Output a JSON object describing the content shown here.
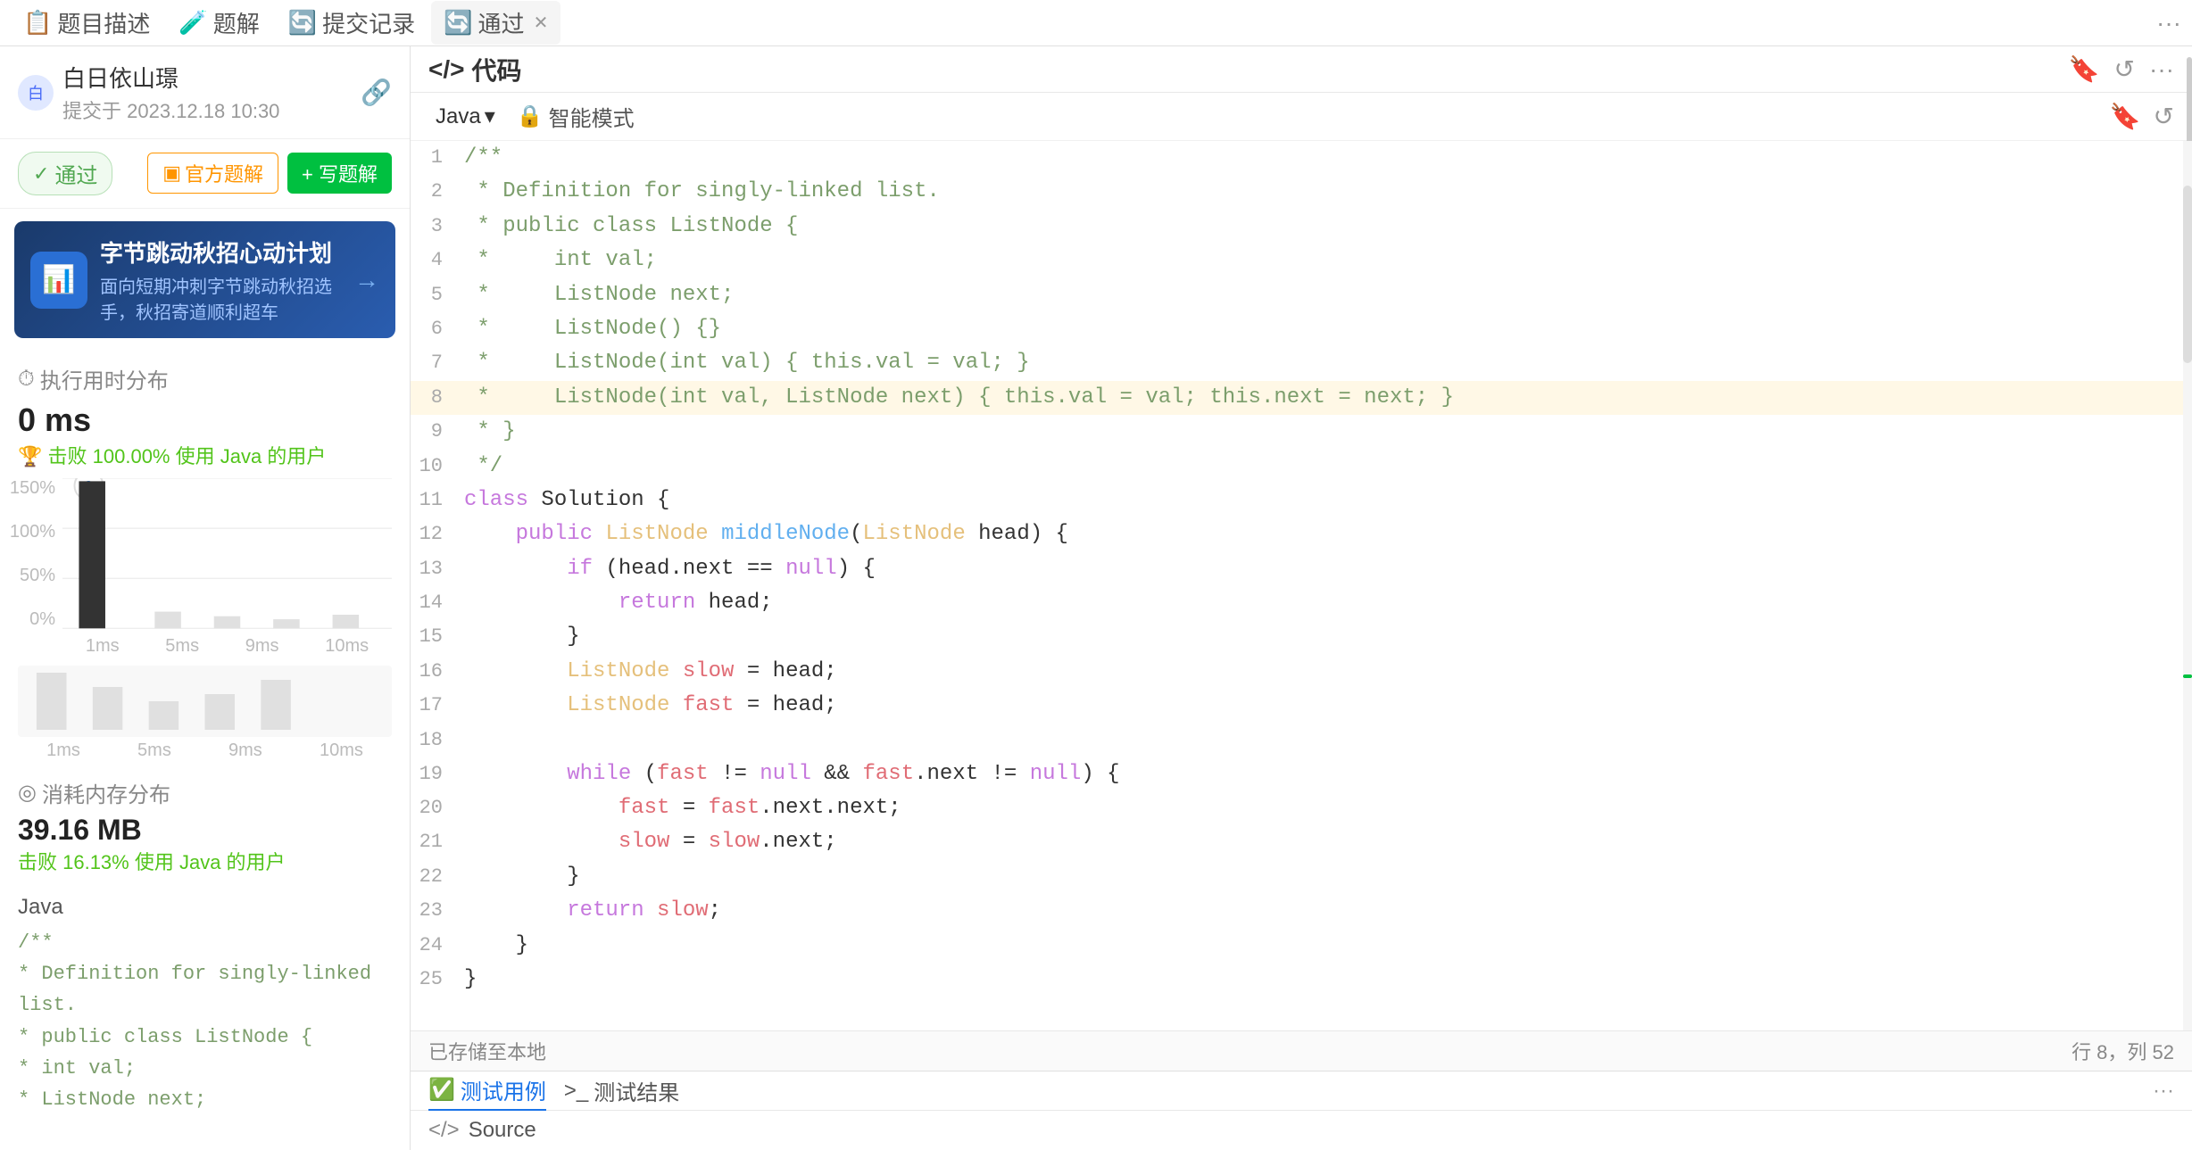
{
  "nav": {
    "tabs": [
      {
        "id": "description",
        "label": "题目描述",
        "icon": "📋",
        "active": false
      },
      {
        "id": "solution",
        "label": "题解",
        "icon": "🧪",
        "active": false
      },
      {
        "id": "submissions",
        "label": "提交记录",
        "icon": "🔄",
        "active": false
      },
      {
        "id": "pass",
        "label": "通过",
        "icon": "🔄",
        "active": true,
        "closable": true
      }
    ],
    "more_icon": "⋯"
  },
  "user": {
    "avatar_letter": "白",
    "name": "白日依山璟",
    "submit_label": "提交于",
    "submit_date": "2023.12.18 10:30",
    "link_icon": "🔗"
  },
  "status": {
    "label": "通过",
    "btn_official": "官方题解",
    "btn_write": "+ 写题解"
  },
  "ad": {
    "title": "字节跳动秋招心动计划",
    "subtitle": "面向短期冲刺字节跳动秋招选手，秋招寄道顺利超车",
    "arrow": "→"
  },
  "runtime": {
    "section_title": "执行用时分布",
    "clock_icon": "⏱",
    "value": "0 ms",
    "beat_icon": "🏆",
    "beat_text": "击败 100.00% 使用 Java 的用户"
  },
  "memory": {
    "section_title": "消耗内存分布",
    "circle_icon": "◎",
    "value": "39.16 MB",
    "beat_text": "击败 16.13% 使用 Java 的用户"
  },
  "chart": {
    "y_labels": [
      "150%",
      "100%",
      "50%",
      "0%"
    ],
    "x_labels": [
      "1ms",
      "5ms",
      "9ms",
      "10ms"
    ],
    "x_labels2": [
      "1ms",
      "5ms",
      "9ms",
      "10ms"
    ]
  },
  "code_left": {
    "lang": "Java",
    "lines": [
      "/**",
      " * Definition for singly-linked list.",
      " * public class ListNode {",
      " *     int val;",
      " *     ListNode next;"
    ]
  },
  "editor": {
    "title": "</> 代码",
    "more_icon": "⋯",
    "bookmark_icon": "🔖",
    "refresh_icon": "↺",
    "lang": "Java",
    "smart_mode": "智能模式",
    "lock_icon": "🔒",
    "status_saved": "已存储至本地",
    "position": "行 8，列 52"
  },
  "code_lines": [
    {
      "num": 1,
      "content": "/**",
      "type": "comment"
    },
    {
      "num": 2,
      "content": " * Definition for singly-linked list.",
      "type": "comment"
    },
    {
      "num": 3,
      "content": " * public class ListNode {",
      "type": "comment"
    },
    {
      "num": 4,
      "content": " *     int val;",
      "type": "comment"
    },
    {
      "num": 5,
      "content": " *     ListNode next;",
      "type": "comment"
    },
    {
      "num": 6,
      "content": " *     ListNode() {}",
      "type": "comment"
    },
    {
      "num": 7,
      "content": " *     ListNode(int val) { this.val = val; }",
      "type": "comment"
    },
    {
      "num": 8,
      "content": " *     ListNode(int val, ListNode next) { this.val = val; this.next = next; }",
      "type": "comment_highlight"
    },
    {
      "num": 9,
      "content": " * }",
      "type": "comment"
    },
    {
      "num": 10,
      "content": " */",
      "type": "comment"
    },
    {
      "num": 11,
      "content": "class Solution {",
      "type": "code"
    },
    {
      "num": 12,
      "content": "    public ListNode middleNode(ListNode head) {",
      "type": "code"
    },
    {
      "num": 13,
      "content": "        if (head.next == null) {",
      "type": "code"
    },
    {
      "num": 14,
      "content": "            return head;",
      "type": "code"
    },
    {
      "num": 15,
      "content": "        }",
      "type": "code"
    },
    {
      "num": 16,
      "content": "        ListNode slow = head;",
      "type": "code"
    },
    {
      "num": 17,
      "content": "        ListNode fast = head;",
      "type": "code"
    },
    {
      "num": 18,
      "content": "",
      "type": "code"
    },
    {
      "num": 19,
      "content": "        while (fast != null && fast.next != null) {",
      "type": "code"
    },
    {
      "num": 20,
      "content": "            fast = fast.next.next;",
      "type": "code"
    },
    {
      "num": 21,
      "content": "            slow = slow.next;",
      "type": "code"
    },
    {
      "num": 22,
      "content": "        }",
      "type": "code"
    },
    {
      "num": 23,
      "content": "        return slow;",
      "type": "code"
    },
    {
      "num": 24,
      "content": "    }",
      "type": "code"
    },
    {
      "num": 25,
      "content": "}",
      "type": "code"
    }
  ],
  "bottom": {
    "tab_test_case": "✅ 测试用例",
    "tab_test_result": ">_ 测试结果",
    "more_icon": "⋯",
    "source_label": "Source",
    "source_icon": "</>"
  }
}
